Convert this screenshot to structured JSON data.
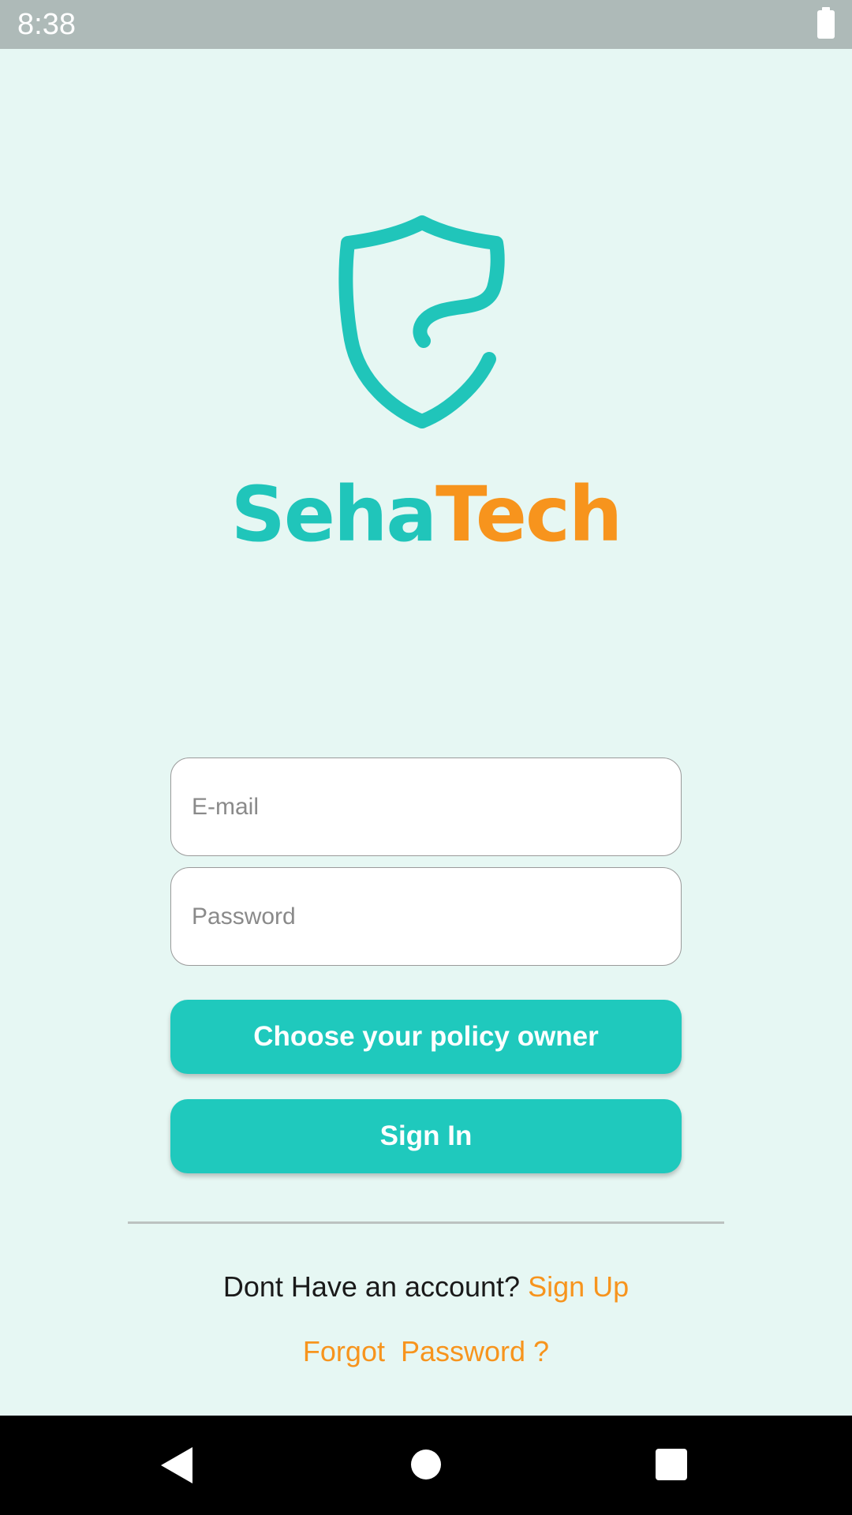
{
  "status_bar": {
    "time": "8:38",
    "battery_icon": "battery-full-icon"
  },
  "logo": {
    "icon": "shield-icon",
    "brand_part_1": "Seha",
    "brand_part_2": "Tech",
    "colors": {
      "primary": "#20c5ba",
      "accent": "#f7941d"
    }
  },
  "form": {
    "email_placeholder": "E-mail",
    "email_value": "",
    "password_placeholder": "Password",
    "password_value": "",
    "policy_button_label": "Choose your policy owner",
    "signin_button_label": "Sign In"
  },
  "footer": {
    "signup_prompt": "Dont Have an account?",
    "signup_link": "Sign Up",
    "forgot_password": "Forgot  Password ?"
  },
  "nav_bar": {
    "back_icon": "back-triangle-icon",
    "home_icon": "home-circle-icon",
    "recent_icon": "recent-apps-square-icon"
  },
  "theme": {
    "background": "#e6f7f3",
    "button_color": "#1fc9bd",
    "link_color": "#f7941d"
  }
}
